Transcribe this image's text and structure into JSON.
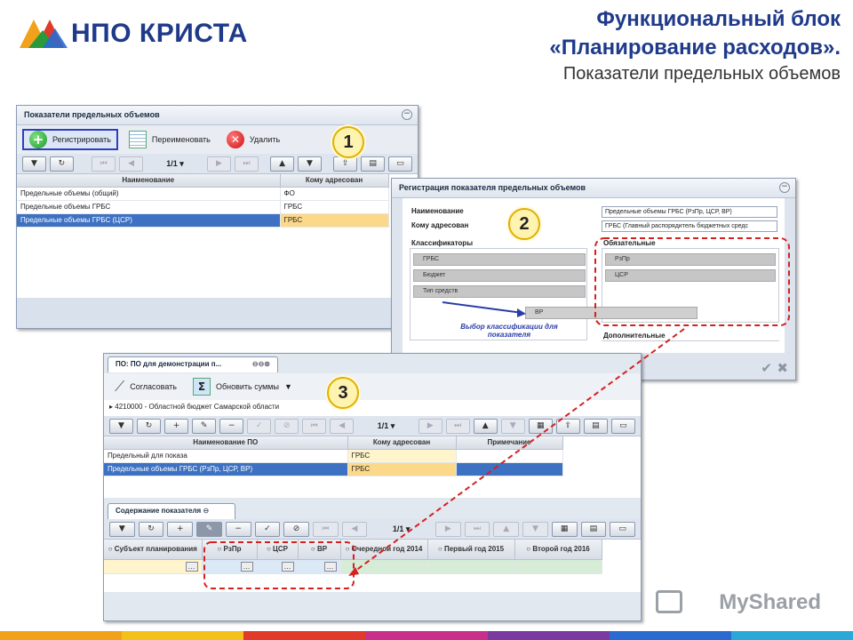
{
  "header": {
    "logo_text": "НПО КРИСТА",
    "title_line1": "Функциональный блок",
    "title_line2": "«Планирование расходов».",
    "subtitle": "Показатели предельных объемов"
  },
  "window1": {
    "title": "Показатели предельных объемов",
    "buttons": {
      "register": "Регистрировать",
      "rename": "Переименовать",
      "delete": "Удалить"
    },
    "pager": "1/1",
    "columns": [
      "Наименование",
      "Кому адресован"
    ],
    "rows": [
      {
        "name": "Предельные объемы (общий)",
        "addr": "ФО"
      },
      {
        "name": "Предельные объемы ГРБС",
        "addr": "ГРБС"
      },
      {
        "name": "Предельные объемы ГРБС (ЦСР)",
        "addr": "ГРБС"
      }
    ],
    "badge": "1"
  },
  "window2": {
    "title": "Регистрация показателя предельных объемов",
    "name_label": "Наименование",
    "name_value": "Предельные объемы ГРБС (РзПр, ЦСР, ВР)",
    "addr_label": "Кому адресован",
    "addr_value": "ГРБС (Главный распорядитель бюджетных средс",
    "classifiers_label": "Классификаторы",
    "required_label": "Обязательные",
    "additional_label": "Дополнительные",
    "classifiers": [
      "ГРБС",
      "Бюджет",
      "Тип средств"
    ],
    "required": [
      "РзПр",
      "ЦСР"
    ],
    "dragged": "ВР",
    "hint": "Выбор классификации для показателя",
    "badge": "2"
  },
  "window3": {
    "tab_title": "ПО: ПО для демонстрации п...",
    "buttons": {
      "approve": "Согласовать",
      "update_sums": "Обновить суммы"
    },
    "budget_path": "4210000 - Областной бюджет Самарской области",
    "pager": "1/1",
    "columns": [
      "Наименование ПО",
      "Кому адресован",
      "Примечание"
    ],
    "rows": [
      {
        "name": "Предельный для показа",
        "addr": "ГРБС",
        "note": ""
      },
      {
        "name": "Предельные объемы ГРБС (РзПр, ЦСР, ВР)",
        "addr": "ГРБС",
        "note": ""
      }
    ],
    "sub_tab": "Содержание показателя",
    "sub_pager": "1/1",
    "sub_columns": [
      "Субъект планирования",
      "РзПр",
      "ЦСР",
      "ВР",
      "Очередной год 2014",
      "Первый год 2015",
      "Второй год 2016"
    ],
    "badge": "3"
  },
  "watermark": "MyShared",
  "colors": {
    "title_blue": "#1f3a8a",
    "selection": "#3d71c2",
    "dashed_red": "#d62020"
  }
}
